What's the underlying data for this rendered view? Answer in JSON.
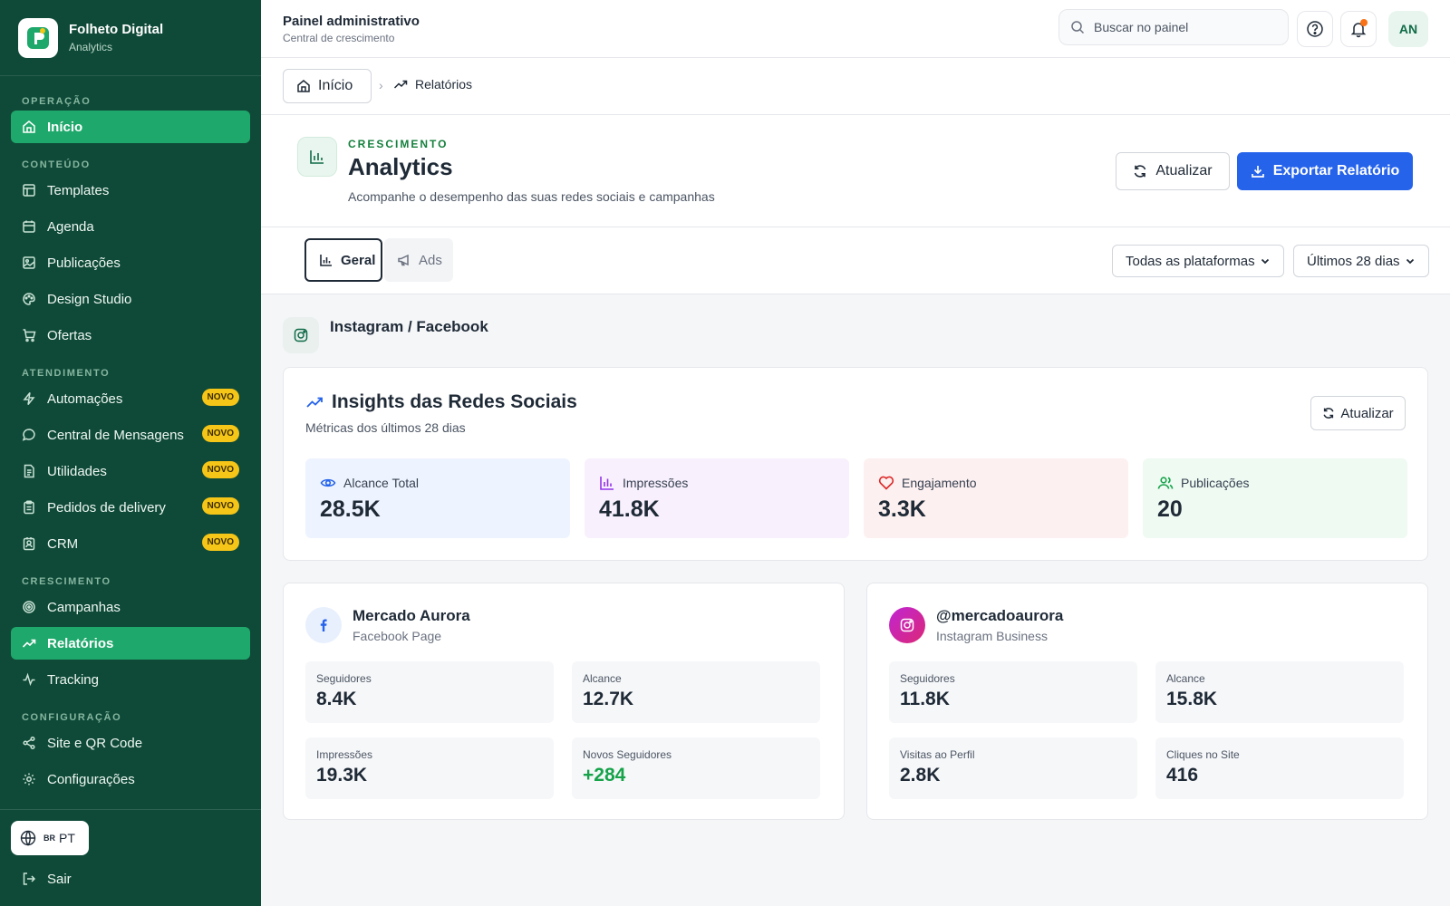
{
  "brand": {
    "title": "Folheto Digital",
    "subtitle": "Analytics"
  },
  "sidebar": {
    "sections": [
      {
        "label": "OPERAÇÃO"
      },
      {
        "label": "CONTEÚDO"
      },
      {
        "label": "ATENDIMENTO"
      },
      {
        "label": "CRESCIMENTO"
      },
      {
        "label": "CONFIGURAÇÃO"
      }
    ],
    "items": [
      {
        "label": "Início",
        "icon": "home-icon",
        "active": true
      },
      {
        "label": "Templates",
        "icon": "layout-icon"
      },
      {
        "label": "Agenda",
        "icon": "calendar-icon"
      },
      {
        "label": "Publicações",
        "icon": "image-icon"
      },
      {
        "label": "Design Studio",
        "icon": "palette-icon"
      },
      {
        "label": "Ofertas",
        "icon": "cart-icon"
      },
      {
        "label": "Automações",
        "icon": "zap-icon",
        "badge": "NOVO"
      },
      {
        "label": "Central de Mensagens",
        "icon": "message-icon",
        "badge": "NOVO"
      },
      {
        "label": "Utilidades",
        "icon": "file-icon",
        "badge": "NOVO"
      },
      {
        "label": "Pedidos de delivery",
        "icon": "clipboard-icon",
        "badge": "NOVO"
      },
      {
        "label": "CRM",
        "icon": "contact-icon",
        "badge": "NOVO"
      },
      {
        "label": "Campanhas",
        "icon": "target-icon"
      },
      {
        "label": "Relatórios",
        "icon": "trending-up-icon",
        "active": true
      },
      {
        "label": "Tracking",
        "icon": "activity-icon"
      },
      {
        "label": "Site e QR Code",
        "icon": "share-icon"
      },
      {
        "label": "Configurações",
        "icon": "gear-icon"
      }
    ],
    "language": {
      "flag": "BR",
      "code": "PT"
    },
    "logout": "Sair"
  },
  "topbar": {
    "title": "Painel administrativo",
    "subtitle": "Central de crescimento",
    "search_placeholder": "Buscar no painel",
    "avatar_initials": "AN"
  },
  "breadcrumb": {
    "home": "Início",
    "current": "Relatórios"
  },
  "header": {
    "eyebrow": "CRESCIMENTO",
    "title": "Analytics",
    "description": "Acompanhe o desempenho das suas redes sociais e campanhas",
    "refresh_label": "Atualizar",
    "export_label": "Exportar Relatório"
  },
  "filters": {
    "tabs": [
      {
        "label": "Geral",
        "active": true
      },
      {
        "label": "Ads"
      }
    ],
    "platform": "Todas as plataformas",
    "period": "Últimos 28 dias"
  },
  "platform_title": "Instagram / Facebook",
  "insights": {
    "title": "Insights das Redes Sociais",
    "subtitle": "Métricas dos últimos 28 dias",
    "refresh_label": "Atualizar",
    "metrics": [
      {
        "label": "Alcance Total",
        "value": "28.5K",
        "icon": "eye-icon",
        "bg": "#eef4ff",
        "color": "#2563eb"
      },
      {
        "label": "Impressões",
        "value": "41.8K",
        "icon": "bar-chart-icon",
        "bg": "#f8f0fd",
        "color": "#9333ea"
      },
      {
        "label": "Engajamento",
        "value": "3.3K",
        "icon": "heart-icon",
        "bg": "#fdf0f0",
        "color": "#dc2626"
      },
      {
        "label": "Publicações",
        "value": "20",
        "icon": "users-icon",
        "bg": "#eefaf2",
        "color": "#16a34a"
      }
    ]
  },
  "profiles": [
    {
      "name": "Mercado Aurora",
      "type": "Facebook Page",
      "icon": "facebook-icon",
      "stats": [
        {
          "label": "Seguidores",
          "value": "8.4K"
        },
        {
          "label": "Alcance",
          "value": "12.7K"
        },
        {
          "label": "Impressões",
          "value": "19.3K"
        },
        {
          "label": "Novos Seguidores",
          "value": "+284",
          "positive": true
        }
      ]
    },
    {
      "name": "@mercadoaurora",
      "type": "Instagram Business",
      "icon": "instagram-icon",
      "stats": [
        {
          "label": "Seguidores",
          "value": "11.8K"
        },
        {
          "label": "Alcance",
          "value": "15.8K"
        },
        {
          "label": "Visitas ao Perfil",
          "value": "2.8K"
        },
        {
          "label": "Cliques no Site",
          "value": "416"
        }
      ]
    }
  ]
}
